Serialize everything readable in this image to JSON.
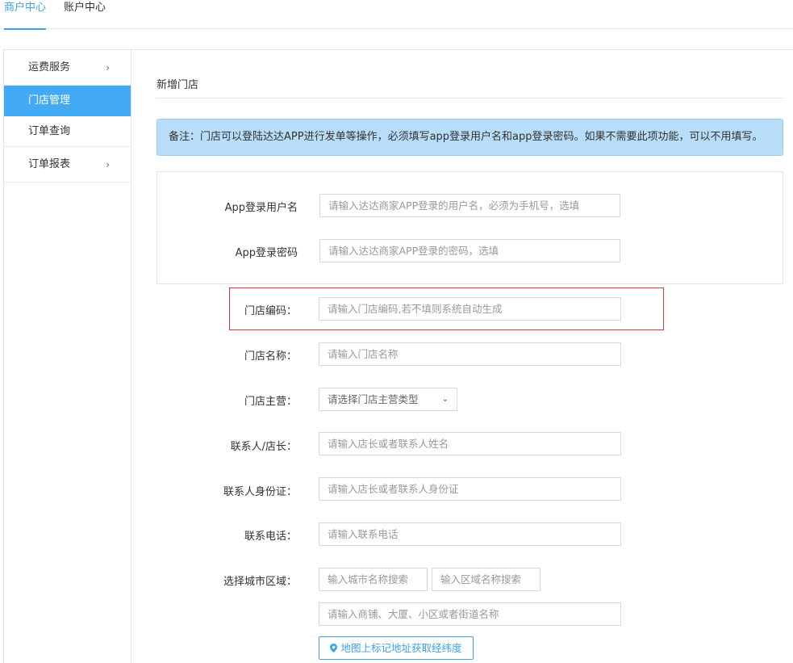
{
  "top_tabs": [
    {
      "label": "商户中心",
      "active": true
    },
    {
      "label": "账户中心",
      "active": false
    }
  ],
  "sidebar": {
    "items": [
      {
        "label": "运费服务",
        "chevron": "›"
      },
      {
        "label": "门店管理",
        "active": true
      },
      {
        "label": "订单查询"
      },
      {
        "label": "订单报表",
        "chevron": "›"
      }
    ]
  },
  "page": {
    "title": "新增门店",
    "notice": "备注：门店可以登陆达达APP进行发单等操作，必须填写app登录用户名和app登录密码。如果不需要此项功能，可以不用填写。"
  },
  "form": {
    "app_username": {
      "label": "App登录用户名",
      "placeholder": "请输入达达商家APP登录的用户名，必须为手机号，选填"
    },
    "app_password": {
      "label": "App登录密码",
      "placeholder": "请输入达达商家APP登录的密码，选填"
    },
    "store_code": {
      "label": "门店编码：",
      "placeholder": "请输入门店编码,若不填则系统自动生成"
    },
    "store_name": {
      "label": "门店名称：",
      "placeholder": "请输入门店名称"
    },
    "store_type": {
      "label": "门店主营：",
      "selected": "请选择门店主营类型"
    },
    "contact_name": {
      "label": "联系人/店长：",
      "placeholder": "请输入店长或者联系人姓名"
    },
    "contact_id": {
      "label": "联系人身份证：",
      "placeholder": "请输入店长或者联系人身份证"
    },
    "contact_phone": {
      "label": "联系电话：",
      "placeholder": "请输入联系电话"
    },
    "city_area": {
      "label": "选择城市区域：",
      "city_placeholder": "输入城市名称搜索",
      "district_placeholder": "输入区域名称搜索",
      "address_placeholder": "请输入商铺、大厦、小区或者街道名称"
    },
    "map_button": "地图上标记地址获取经纬度"
  },
  "colors": {
    "accent": "#3da1f0",
    "sidebar_active": "#42a9f4",
    "notice_bg": "#b8ddf8",
    "highlight_border": "#d9363e"
  },
  "icons": {
    "chevron": "chevron-right-icon",
    "caret": "chevron-down-icon",
    "map_pin": "map-pin-icon"
  }
}
